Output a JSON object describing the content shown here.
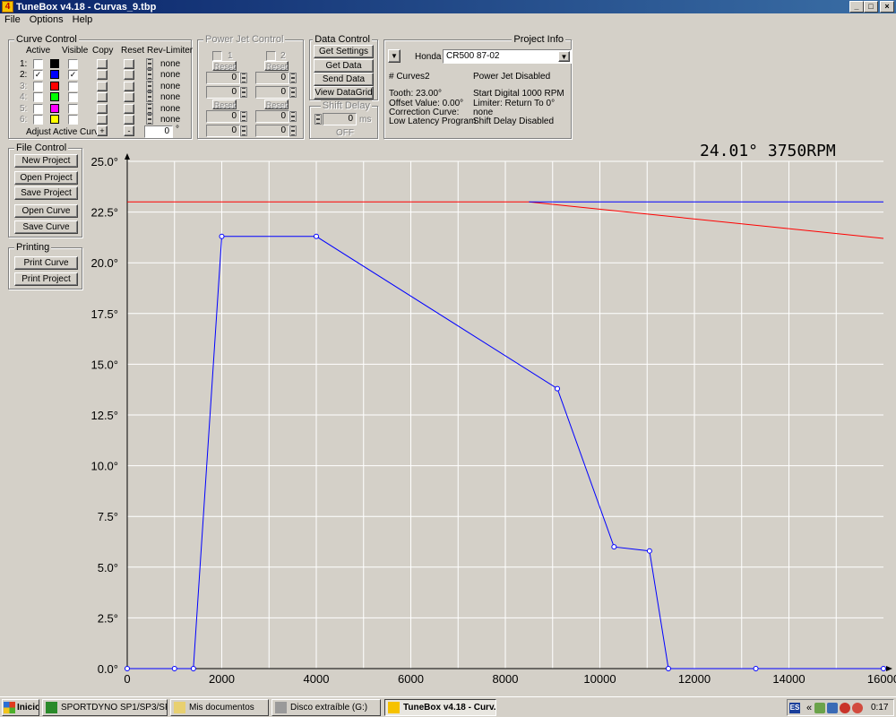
{
  "window": {
    "title": "TuneBox v4.18 - Curvas_9.tbp",
    "icon_char": "4"
  },
  "menu": [
    "File",
    "Options",
    "Help"
  ],
  "curve_control": {
    "title": "Curve Control",
    "headers": {
      "active": "Active",
      "visible": "Visible",
      "copy": "Copy",
      "reset": "Reset",
      "rev_limiter": "Rev-Limiter"
    },
    "rows": [
      {
        "label": "1:",
        "color": "#000000",
        "active": false,
        "visible": false,
        "rev": "none",
        "enabled": true
      },
      {
        "label": "2:",
        "color": "#0000ff",
        "active": true,
        "visible": true,
        "rev": "none",
        "enabled": true
      },
      {
        "label": "3:",
        "color": "#ff0000",
        "active": false,
        "visible": false,
        "rev": "none",
        "enabled": false
      },
      {
        "label": "4:",
        "color": "#00ff00",
        "active": false,
        "visible": false,
        "rev": "none",
        "enabled": false
      },
      {
        "label": "5:",
        "color": "#ff00ff",
        "active": false,
        "visible": false,
        "rev": "none",
        "enabled": false
      },
      {
        "label": "6:",
        "color": "#ffff00",
        "active": false,
        "visible": false,
        "rev": "none",
        "enabled": false
      }
    ],
    "adjust_label": "Adjust Active Curve:",
    "plus": "+",
    "minus": "-",
    "adjust_value": "0",
    "degree": "°"
  },
  "power_jet": {
    "title": "Power Jet Control",
    "ch1": "1",
    "ch2": "2",
    "reset": "Reset",
    "values": [
      "0",
      "0",
      "0",
      "0",
      "0",
      "0",
      "0",
      "0"
    ]
  },
  "data_control": {
    "title": "Data Control",
    "buttons": [
      "Get Settings",
      "Get Data",
      "Send Data",
      "View DataGrid"
    ]
  },
  "shift_delay": {
    "title": "Shift Delay",
    "value": "0",
    "unit": "ms",
    "state": "OFF"
  },
  "project_info": {
    "title": "Project Info",
    "make": "Honda",
    "model": "CR500 87-02",
    "curves": "# Curves2",
    "power_jet": "Power Jet Disabled",
    "tooth": "Tooth:  23.00°",
    "start": "Start Digital 1000 RPM",
    "offset": "Offset Value: 0.00°",
    "limiter": "Limiter: Return To 0°",
    "correction_label": "Correction Curve:",
    "correction_value": "none",
    "low_latency": "Low Latency Program",
    "shift_delay": "Shift Delay Disabled"
  },
  "file_control": {
    "title": "File Control",
    "buttons": [
      "New Project",
      "Open Project",
      "Save Project",
      "Open Curve",
      "Save Curve"
    ]
  },
  "printing": {
    "title": "Printing",
    "buttons": [
      "Print Curve",
      "Print Project"
    ]
  },
  "readout": "24.01°  3750RPM",
  "chart_data": {
    "type": "line",
    "xlim": [
      0,
      16000
    ],
    "ylim": [
      0,
      25
    ],
    "x_ticks": [
      "0",
      "2000",
      "4000",
      "6000",
      "8000",
      "10000",
      "12000",
      "14000",
      "16000"
    ],
    "y_ticks": [
      "0.0°",
      "2.5°",
      "5.0°",
      "7.5°",
      "10.0°",
      "12.5°",
      "15.0°",
      "17.5°",
      "20.0°",
      "22.5°",
      "25.0°"
    ],
    "grid": true,
    "series": [
      {
        "color": "#0000ff",
        "markers": true,
        "points": [
          [
            0,
            0
          ],
          [
            1000,
            0
          ],
          [
            1400,
            0
          ],
          [
            2000,
            21.3
          ],
          [
            4000,
            21.3
          ],
          [
            9100,
            13.8
          ],
          [
            10300,
            6.0
          ],
          [
            11050,
            5.8
          ],
          [
            11450,
            0
          ],
          [
            13300,
            0
          ],
          [
            16000,
            0
          ]
        ]
      },
      {
        "color": "#ff0000",
        "markers": false,
        "points": [
          [
            0,
            23.0
          ],
          [
            8500,
            23.0
          ],
          [
            16000,
            21.2
          ]
        ]
      },
      {
        "color": "#0000ff",
        "markers": false,
        "points": [
          [
            8500,
            23.0
          ],
          [
            16000,
            23.0
          ]
        ]
      }
    ]
  },
  "taskbar": {
    "start": "Inicio",
    "items": [
      {
        "label": "SPORTDYNO SP1/SP3/SP...",
        "active": false,
        "icon_color": "#2a8a2a"
      },
      {
        "label": "Mis documentos",
        "active": false,
        "icon_color": "#e8d070"
      },
      {
        "label": "Disco extraíble (G:)",
        "active": false,
        "icon_color": "#9a9a9a"
      },
      {
        "label": "TuneBox v4.18 - Curv...",
        "active": true,
        "icon_color": "#f6c200"
      }
    ],
    "lang": "ES",
    "chevron": "«",
    "clock": "0:17"
  }
}
